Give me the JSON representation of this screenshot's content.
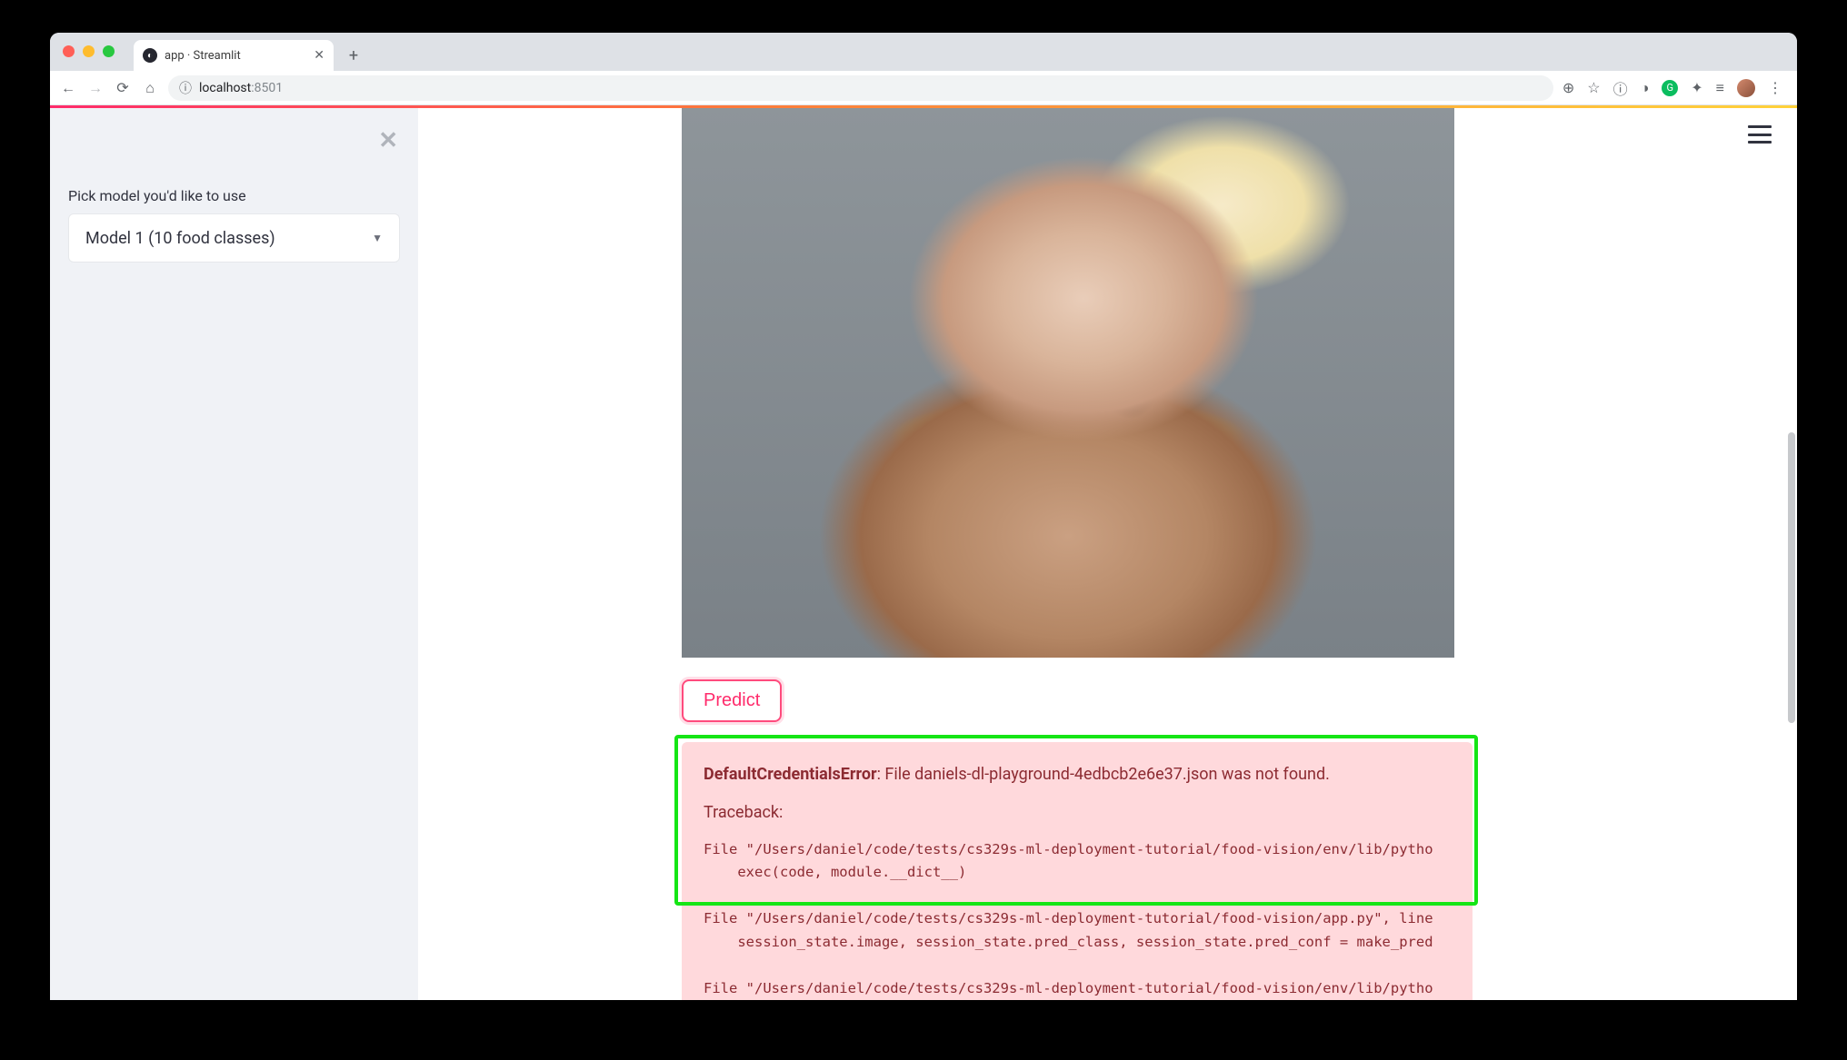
{
  "browser": {
    "tab_title": "app · Streamlit",
    "url_host": "localhost",
    "url_port": ":8501"
  },
  "sidebar": {
    "label": "Pick model you'd like to use",
    "selected": "Model 1 (10 food classes)"
  },
  "main": {
    "predict_label": "Predict"
  },
  "error": {
    "name": "DefaultCredentialsError",
    "message": ": File daniels-dl-playground-4edbcb2e6e37.json was not found.",
    "traceback_label": "Traceback:",
    "lines": [
      "File \"/Users/daniel/code/tests/cs329s-ml-deployment-tutorial/food-vision/env/lib/pytho",
      "    exec(code, module.__dict__)",
      "File \"/Users/daniel/code/tests/cs329s-ml-deployment-tutorial/food-vision/app.py\", line",
      "    session_state.image, session_state.pred_class, session_state.pred_conf = make_pred",
      "File \"/Users/daniel/code/tests/cs329s-ml-deployment-tutorial/food-vision/env/lib/pytho"
    ]
  }
}
